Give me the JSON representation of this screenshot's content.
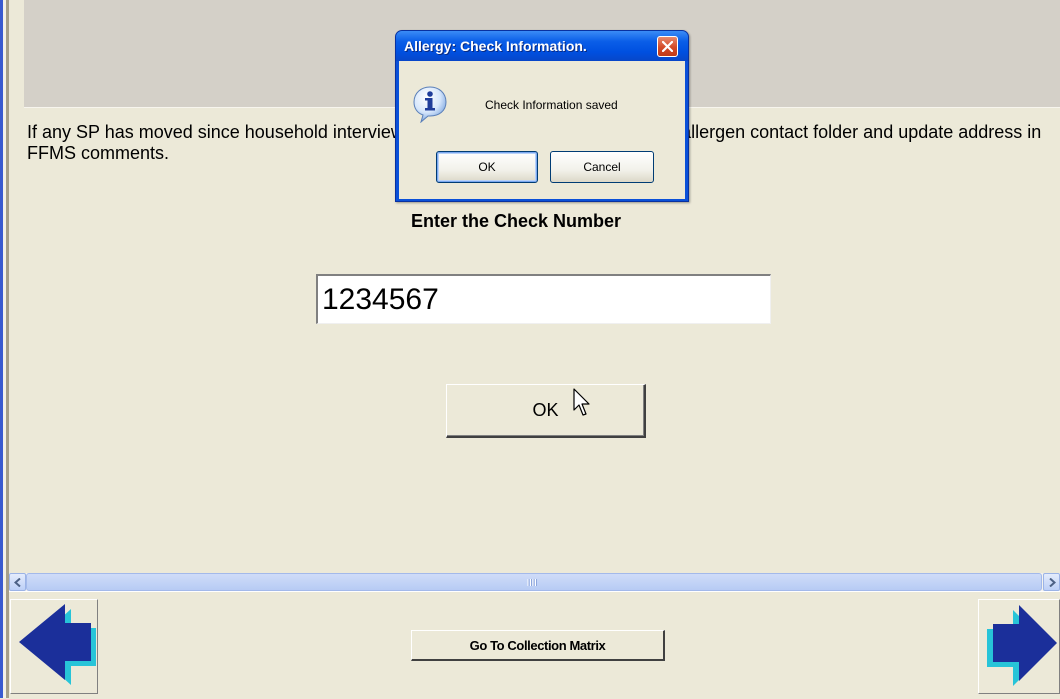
{
  "page": {
    "instructions": "If any SP has moved since household interview, record new address on page 3 of allergen contact folder and update address in FFMS comments.",
    "check_label": "Enter the Check Number",
    "check_value": "1234567",
    "ok_label": "OK"
  },
  "footer": {
    "collection_button": "Go To Collection Matrix",
    "back_icon": "left-arrow-icon",
    "forward_icon": "right-arrow-icon"
  },
  "dialog": {
    "title": "Allergy: Check Information.",
    "message": "Check Information saved",
    "ok_label": "OK",
    "cancel_label": "Cancel",
    "icon": "info-icon"
  },
  "colors": {
    "window_bg": "#ece9d8",
    "title_bar": "#0a5ee8",
    "arrow_fill": "#1b2f9a",
    "arrow_shadow": "#27c4d8"
  }
}
